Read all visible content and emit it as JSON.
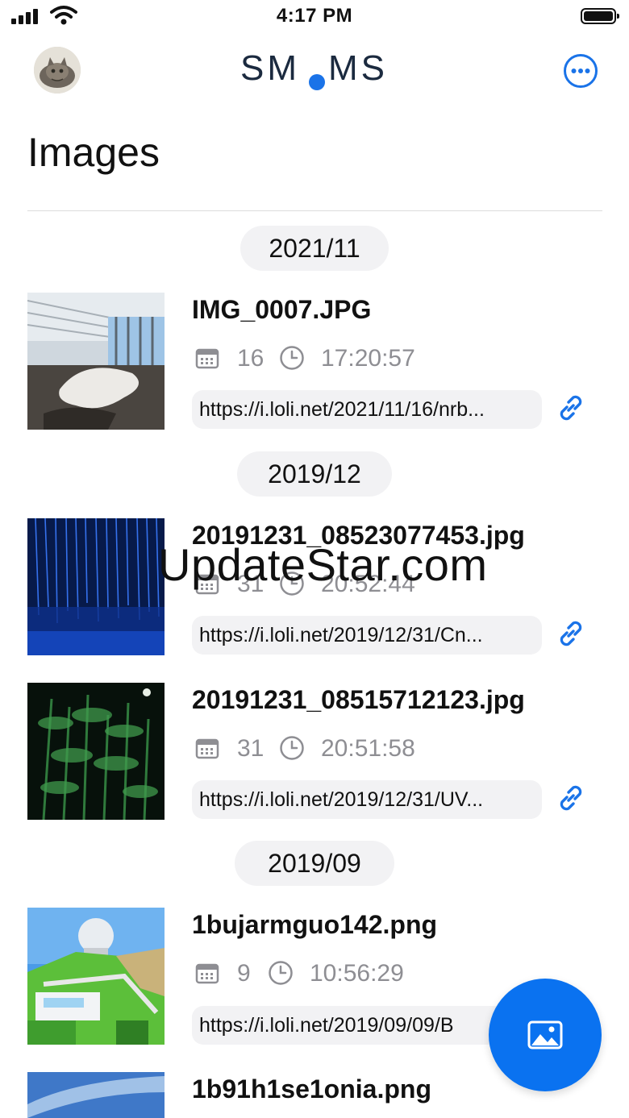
{
  "status": {
    "time": "4:17 PM"
  },
  "nav": {
    "logo_left": "SM",
    "logo_right": "MS",
    "logo_dot_color": "#1a73e8",
    "more_icon": "ellipsis-circle-icon"
  },
  "page": {
    "title": "Images"
  },
  "groups": [
    {
      "month": "2021/11",
      "items": [
        {
          "filename": "IMG_0007.JPG",
          "day": "16",
          "time": "17:20:57",
          "url": "https://i.loli.net/2021/11/16/nrb..."
        }
      ]
    },
    {
      "month": "2019/12",
      "items": [
        {
          "filename": "20191231_08523077453.jpg",
          "day": "31",
          "time": "20:52:44",
          "url": "https://i.loli.net/2019/12/31/Cn..."
        },
        {
          "filename": "20191231_08515712123.jpg",
          "day": "31",
          "time": "20:51:58",
          "url": "https://i.loli.net/2019/12/31/UV..."
        }
      ]
    },
    {
      "month": "2019/09",
      "items": [
        {
          "filename": "1bujarmguo142.png",
          "day": "9",
          "time": "10:56:29",
          "url": "https://i.loli.net/2019/09/09/B"
        },
        {
          "filename": "1b91h1se1onia.png"
        }
      ]
    }
  ],
  "watermark": "UpdateStar.com",
  "fab": {
    "icon": "photo-icon",
    "color": "#0a72f0"
  },
  "colors": {
    "accent": "#1a73e8",
    "meta_gray": "#8e8e93",
    "pill_bg": "#f2f2f4"
  }
}
